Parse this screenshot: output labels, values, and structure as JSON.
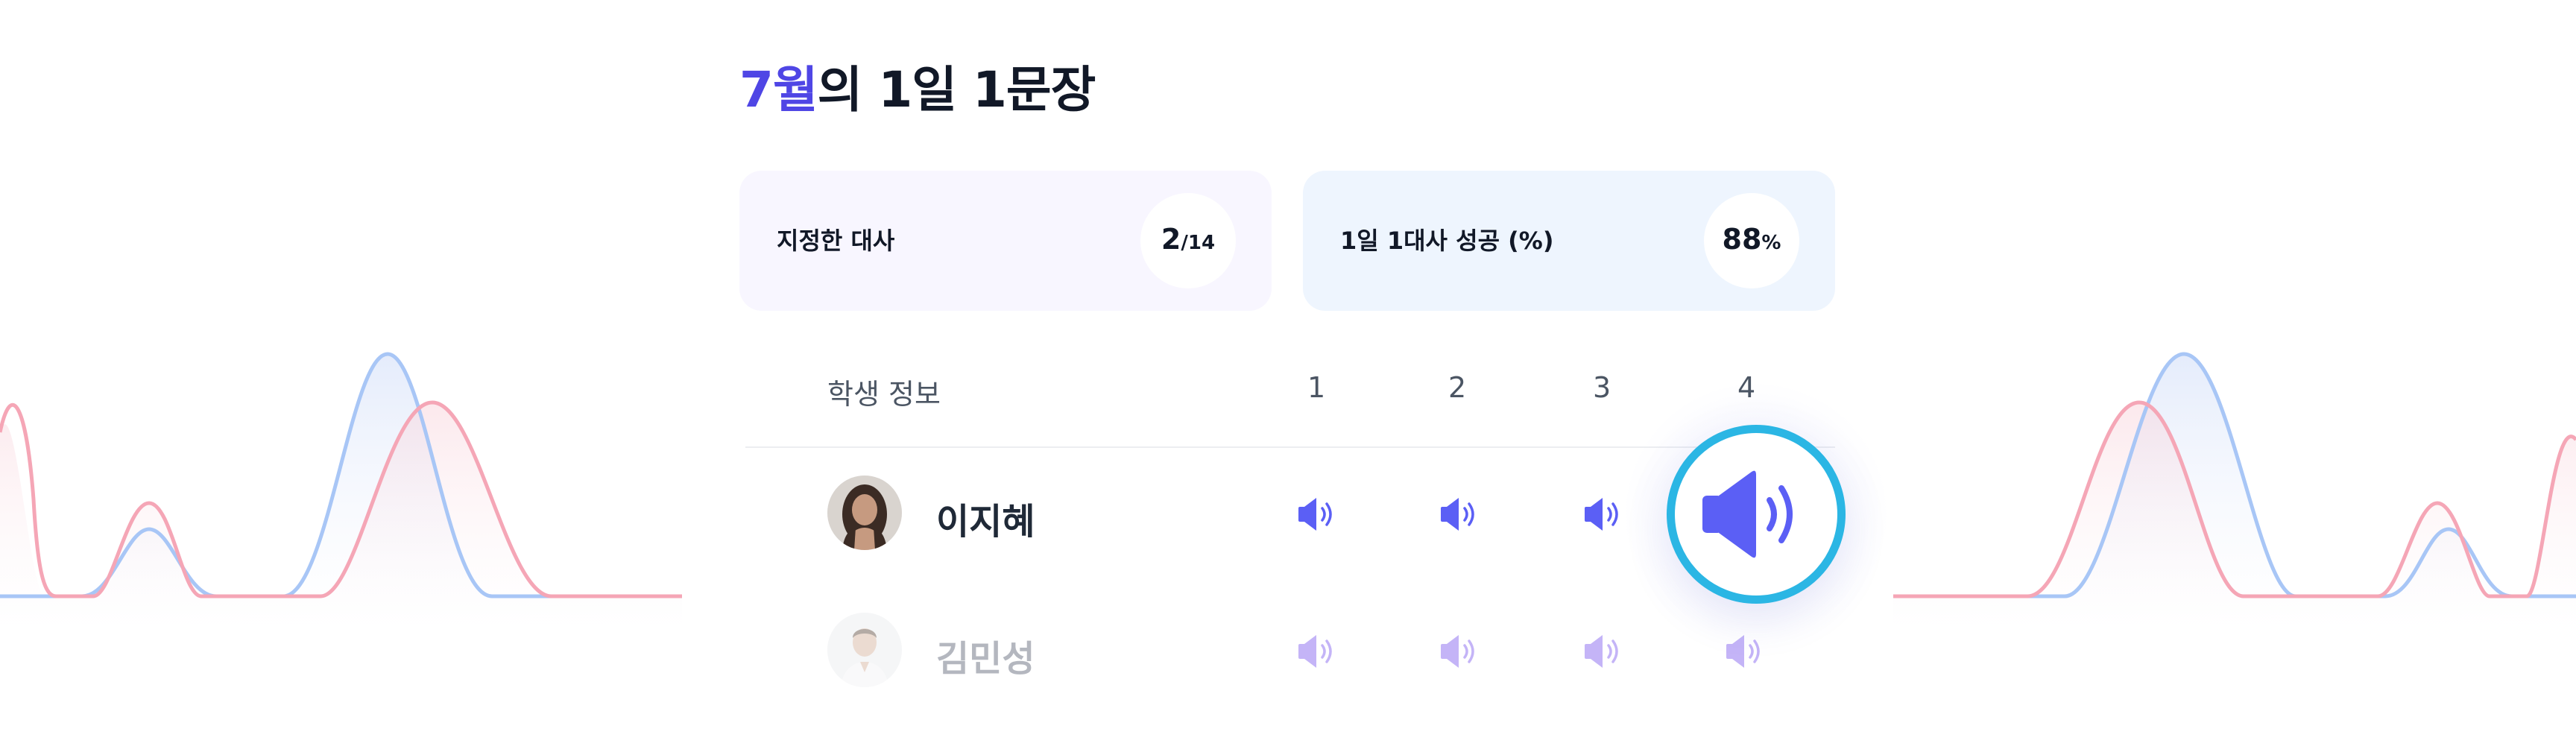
{
  "title": {
    "accent": "7월",
    "rest": "의 1일 1문장"
  },
  "cards": [
    {
      "label": "지정한 대사",
      "value": "2",
      "suffix": "/14"
    },
    {
      "label": "1일 1대사 성공 (%)",
      "value": "88",
      "suffix": "%"
    }
  ],
  "table": {
    "student_header": "학생 정보",
    "columns": [
      "1",
      "2",
      "3",
      "4"
    ],
    "rows": [
      {
        "name": "이지혜"
      },
      {
        "name": "김민성"
      }
    ]
  },
  "colors": {
    "accent": "#4f46e5",
    "speaker": "#5b5ff5",
    "ring": "#2bb6e4",
    "wave_blue": "#a8c6f6",
    "wave_pink": "#f5a6b6"
  },
  "icons": {
    "speaker": "speaker-volume-icon"
  }
}
